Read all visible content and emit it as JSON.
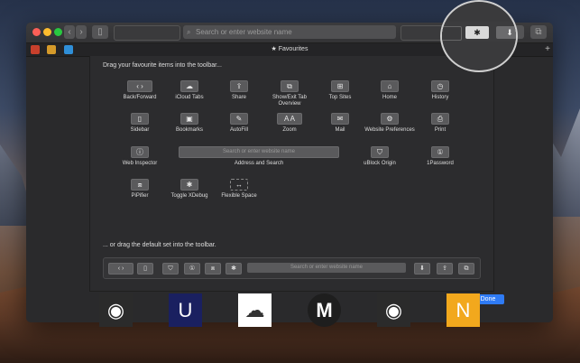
{
  "window": {
    "tab_title": "Favourites",
    "url_placeholder": "Search or enter website name",
    "new_tab": "+"
  },
  "favorites_bar": {
    "icons": [
      "bug-icon",
      "tools-icon",
      "chat-icon"
    ]
  },
  "sheet": {
    "heading": "Drag your favourite items into the toolbar...",
    "items": [
      {
        "glyph": "‹  ›",
        "label": "Back/Forward"
      },
      {
        "glyph": "☁",
        "label": "iCloud Tabs"
      },
      {
        "glyph": "⇪",
        "label": "Share"
      },
      {
        "glyph": "⧉",
        "label": "Show/Exit Tab Overview"
      },
      {
        "glyph": "⊞",
        "label": "Top Sites"
      },
      {
        "glyph": "⌂",
        "label": "Home"
      },
      {
        "glyph": "◷",
        "label": "History"
      },
      {
        "glyph": "▯",
        "label": "Sidebar"
      },
      {
        "glyph": "▣",
        "label": "Bookmarks"
      },
      {
        "glyph": "✎",
        "label": "AutoFill"
      },
      {
        "glyph": "A  A",
        "label": "Zoom"
      },
      {
        "glyph": "✉",
        "label": "Mail"
      },
      {
        "glyph": "⚙",
        "label": "Website Preferences"
      },
      {
        "glyph": "⎙",
        "label": "Print"
      },
      {
        "glyph": "ⓘ",
        "label": "Web Inspector"
      },
      {
        "glyph": "Search or enter website name",
        "label": "Address and Search"
      },
      {
        "glyph": "⛉",
        "label": "uBlock Origin"
      },
      {
        "glyph": "①",
        "label": "1Password"
      },
      {
        "glyph": "⧈",
        "label": "PiPifier"
      },
      {
        "glyph": "✱",
        "label": "Toggle XDebug"
      },
      {
        "glyph": "↔",
        "label": "Flexible Space"
      }
    ],
    "default_heading": "... or drag the default set into the toolbar.",
    "default_url_placeholder": "Search or enter website name",
    "done_label": "Done"
  },
  "dock": {
    "tiles": [
      {
        "name": "github-tile",
        "glyph": "◉",
        "bg": "#2b2b2b"
      },
      {
        "name": "ublock-tile",
        "glyph": "U",
        "bg": "#1a2060"
      },
      {
        "name": "icloud-tile",
        "glyph": "☁",
        "bg": "#ffffff"
      },
      {
        "name": "medium-tile",
        "glyph": "M",
        "bg": "#1e1e1e"
      },
      {
        "name": "github-tile-2",
        "glyph": "◉",
        "bg": "#2b2b2b"
      },
      {
        "name": "n-tile",
        "glyph": "N",
        "bg": "#f2a81d"
      }
    ]
  }
}
